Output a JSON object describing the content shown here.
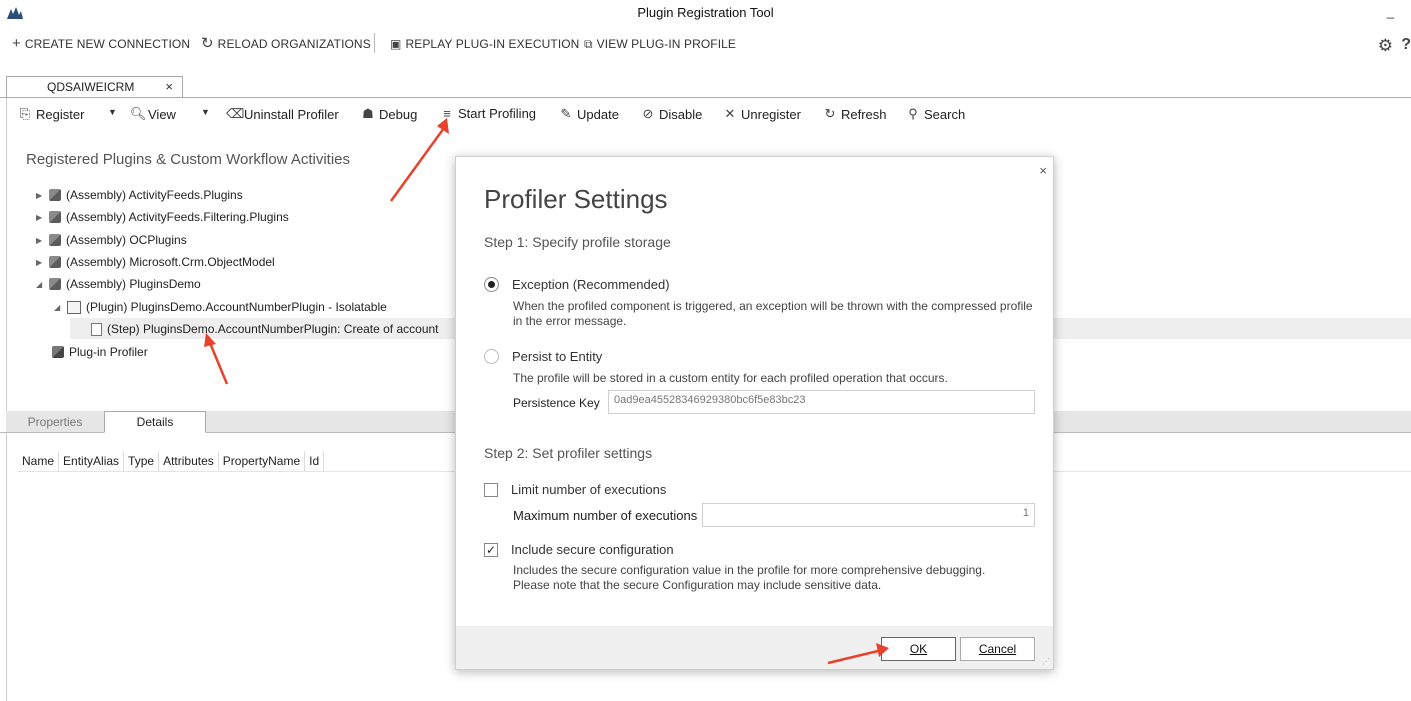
{
  "window": {
    "title": "Plugin Registration Tool",
    "minimize": "_"
  },
  "topbar": {
    "create": "CREATE NEW CONNECTION",
    "reload": "RELOAD ORGANIZATIONS",
    "replay": "REPLAY PLUG-IN EXECUTION",
    "view_profile": "VIEW PLUG-IN PROFILE"
  },
  "org_tab": {
    "label": "QDSAIWEICRM",
    "close": "×"
  },
  "toolbar": {
    "register": "Register",
    "view": "View",
    "uninstall_profiler": "Uninstall Profiler",
    "debug": "Debug",
    "start_profiling": "Start Profiling",
    "update": "Update",
    "disable": "Disable",
    "unregister": "Unregister",
    "refresh": "Refresh",
    "search": "Search"
  },
  "tree": {
    "title": "Registered Plugins & Custom Workflow Activities",
    "items": [
      "(Assembly) ActivityFeeds.Plugins",
      "(Assembly) ActivityFeeds.Filtering.Plugins",
      "(Assembly) OCPlugins",
      "(Assembly) Microsoft.Crm.ObjectModel",
      "(Assembly) PluginsDemo",
      "(Plugin) PluginsDemo.AccountNumberPlugin - Isolatable",
      "(Step) PluginsDemo.AccountNumberPlugin: Create of account",
      "Plug-in Profiler"
    ]
  },
  "panes": {
    "tabs": [
      "Properties",
      "Details"
    ],
    "columns": [
      "Name",
      "EntityAlias",
      "Type",
      "Attributes",
      "PropertyName",
      "Id"
    ]
  },
  "dialog": {
    "title": "Profiler Settings",
    "close": "×",
    "step1": "Step 1: Specify profile storage",
    "exception_label": "Exception (Recommended)",
    "exception_desc": "When the profiled component is triggered, an exception will be thrown with the compressed profile in the error message.",
    "persist_label": "Persist to Entity",
    "persist_desc": "The profile will be stored in a custom entity for each profiled operation that occurs.",
    "persistence_key_label": "Persistence Key",
    "persistence_key_value": "0ad9ea45528346929380bc6f5e83bc23",
    "step2": "Step 2: Set profiler settings",
    "limit_label": "Limit number of executions",
    "max_label": "Maximum number of executions",
    "max_value": "1",
    "secure_label": "Include secure configuration",
    "secure_desc_1": "Includes the secure configuration value in the profile for more comprehensive debugging.",
    "secure_desc_2": "Please note that the secure Configuration may include sensitive data.",
    "ok": "OK",
    "cancel": "Cancel"
  },
  "colors": {
    "arrow": "#e8412c",
    "selection": "#eeeeee"
  }
}
